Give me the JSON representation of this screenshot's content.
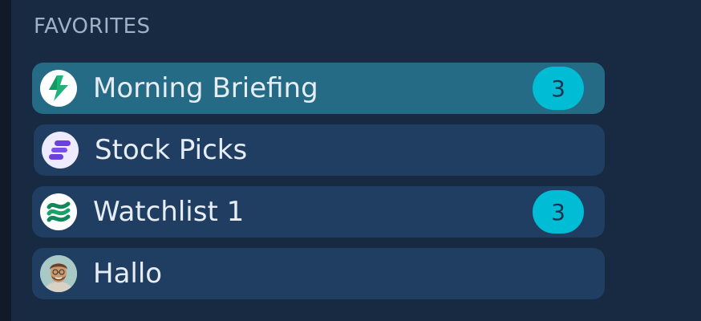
{
  "section": {
    "title": "FAVORITES"
  },
  "favorites": [
    {
      "label": "Morning Briefing",
      "badge": "3",
      "icon": "lightning-icon",
      "active": true
    },
    {
      "label": "Stock Picks",
      "badge": "",
      "icon": "bars-logo-icon",
      "active": false
    },
    {
      "label": "Watchlist 1",
      "badge": "3",
      "icon": "wave-stripes-icon",
      "active": false
    },
    {
      "label": "Hallo",
      "badge": "",
      "icon": "user-avatar-photo",
      "active": false
    }
  ],
  "colors": {
    "background": "#172a42",
    "item": "#1f3e62",
    "item_active": "#256b85",
    "badge": "#00bcd4",
    "lightning_green": "#1db47a",
    "stock_purple": "#6b3fe0"
  }
}
